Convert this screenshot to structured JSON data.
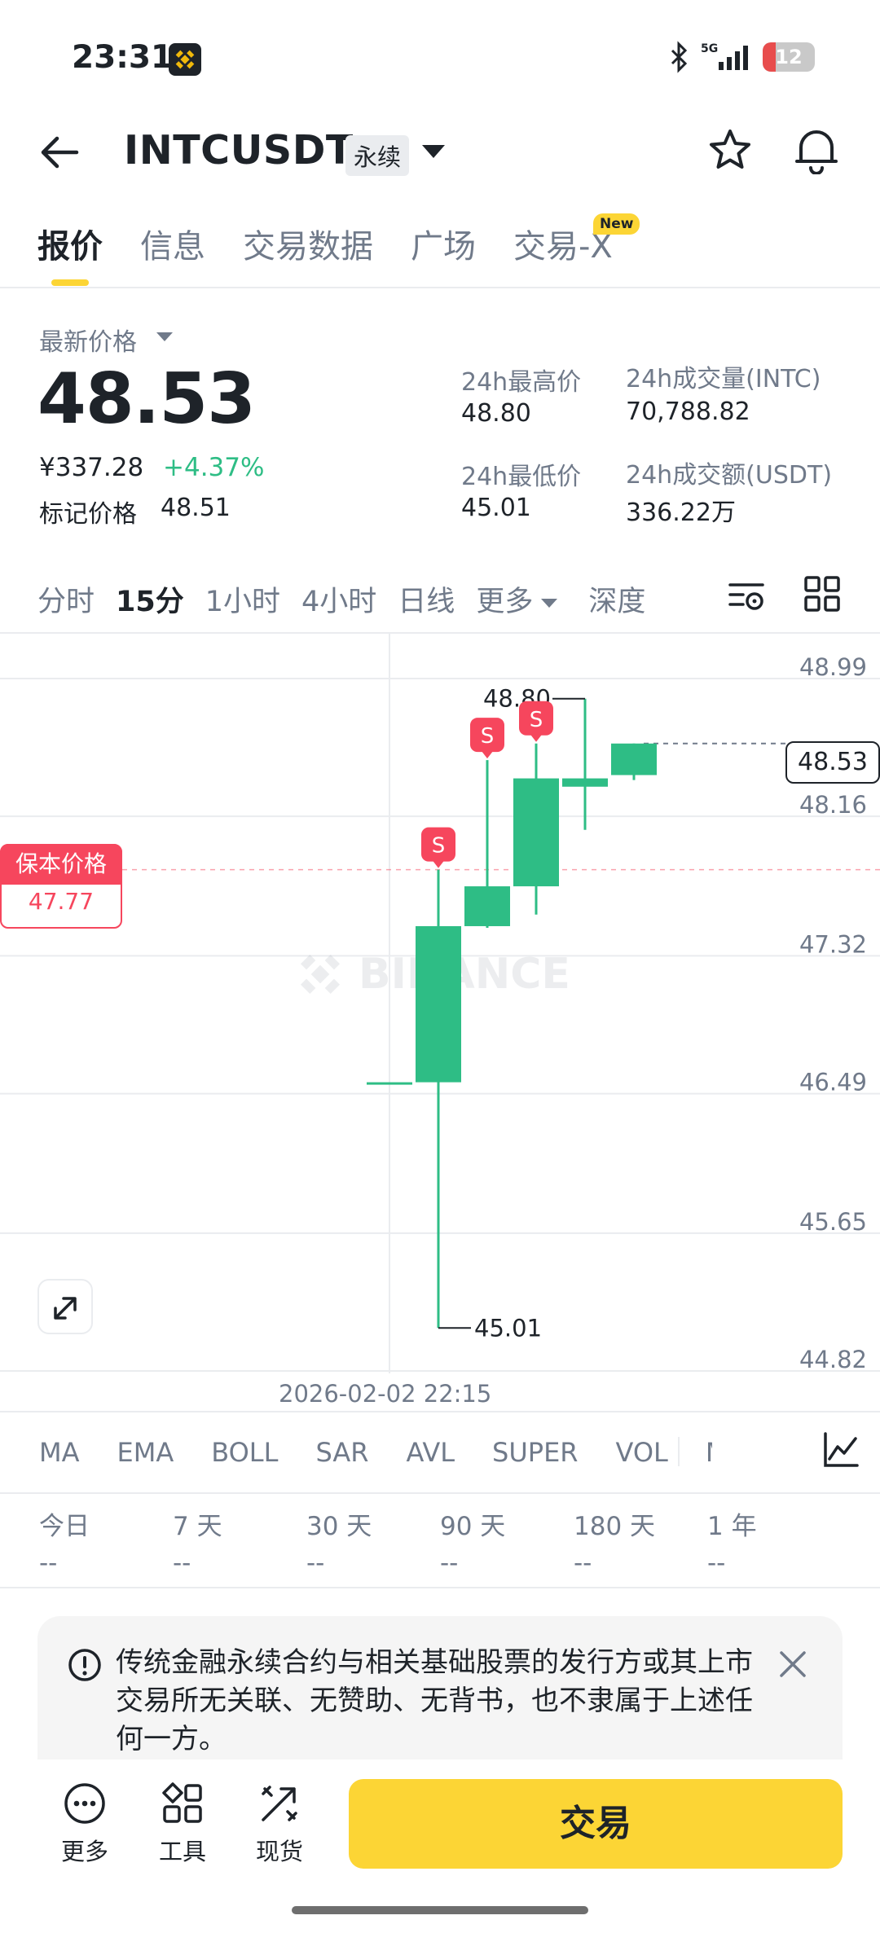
{
  "status_bar": {
    "time": "23:31",
    "network": "5G",
    "battery": "12"
  },
  "header": {
    "symbol": "INTCUSDT",
    "contract_tag": "永续",
    "icons": [
      "back-arrow-icon",
      "star-icon",
      "bell-icon"
    ]
  },
  "tabs": [
    {
      "label": "报价",
      "active": true
    },
    {
      "label": "信息"
    },
    {
      "label": "交易数据"
    },
    {
      "label": "广场"
    },
    {
      "label": "交易-X",
      "badge": "New"
    }
  ],
  "price": {
    "latest_label": "最新价格",
    "last": "48.53",
    "cny": "¥337.28",
    "change_pct": "+4.37%",
    "mark_label": "标记价格",
    "mark_value": "48.51"
  },
  "stats": {
    "high_label": "24h最高价",
    "high": "48.80",
    "low_label": "24h最低价",
    "low": "45.01",
    "vol_base_label": "24h成交量(INTC)",
    "vol_base": "70,788.82",
    "vol_quote_label": "24h成交额(USDT)",
    "vol_quote": "336.22万"
  },
  "intervals": [
    "分时",
    "15分",
    "1小时",
    "4小时",
    "日线",
    "更多",
    "深度"
  ],
  "chart": {
    "y_ticks": [
      "48.99",
      "48.16",
      "47.32",
      "46.49",
      "45.65",
      "44.82"
    ],
    "current_price": "48.53",
    "breakeven_label": "保本价格",
    "breakeven_value": "47.77",
    "high_marker": "48.80",
    "low_marker": "45.01",
    "sell_marker": "S",
    "watermark": "BINANCE",
    "date": "2026-02-02 22:15",
    "up_color": "#2ebd85",
    "down_color": "#f6465d"
  },
  "chart_data": {
    "type": "candlestick",
    "ylim": [
      44.82,
      48.99
    ],
    "candles": [
      {
        "open": 46.49,
        "close": 46.49,
        "high": 46.49,
        "low": 46.49
      },
      {
        "open": 46.49,
        "close": 47.43,
        "high": 47.77,
        "low": 45.01
      },
      {
        "open": 47.43,
        "close": 47.67,
        "high": 48.43,
        "low": 47.42
      },
      {
        "open": 47.67,
        "close": 48.32,
        "high": 48.53,
        "low": 47.5
      },
      {
        "open": 48.27,
        "close": 48.32,
        "high": 48.8,
        "low": 48.01
      },
      {
        "open": 48.34,
        "close": 48.53,
        "high": 48.53,
        "low": 48.31
      }
    ],
    "sell_markers_on": [
      1,
      2,
      3
    ]
  },
  "indicators": [
    "MA",
    "EMA",
    "BOLL",
    "SAR",
    "AVL",
    "SUPER",
    "VOL",
    "M"
  ],
  "performance": [
    {
      "label": "今日",
      "value": "--"
    },
    {
      "label": "7 天",
      "value": "--"
    },
    {
      "label": "30 天",
      "value": "--"
    },
    {
      "label": "90 天",
      "value": "--"
    },
    {
      "label": "180 天",
      "value": "--"
    },
    {
      "label": "1 年",
      "value": "--"
    }
  ],
  "notice": {
    "text": "传统金融永续合约与相关基础股票的发行方或其上市交易所无关联、无赞助、无背书，也不隶属于上述任何一方。"
  },
  "bottom_bar": {
    "more": "更多",
    "tools": "工具",
    "spot": "现货",
    "trade": "交易"
  }
}
